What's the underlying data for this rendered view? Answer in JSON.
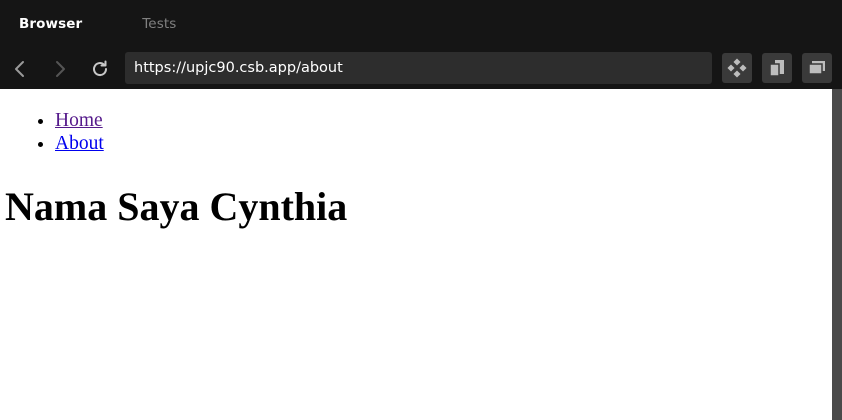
{
  "tabs": [
    {
      "label": "Browser",
      "active": true
    },
    {
      "label": "Tests",
      "active": false
    }
  ],
  "toolbar": {
    "url": "https://upjc90.csb.app/about",
    "back_icon": "chevron-left-icon",
    "forward_icon": "chevron-right-icon",
    "reload_icon": "reload-icon",
    "actions": [
      "codesandbox-icon",
      "open-new-window-icon",
      "layers-icon"
    ]
  },
  "page": {
    "nav_links": [
      {
        "label": "Home",
        "state": "visited"
      },
      {
        "label": "About",
        "state": "link"
      }
    ],
    "heading": "Nama Saya Cynthia"
  },
  "colors": {
    "chrome_bg": "#151515",
    "url_bg": "#2d2d2d",
    "tool_btn_bg": "#3a3a3a",
    "visited_link": "#551a8b",
    "link": "#0000ee",
    "scrollbar": "#4a4a4a"
  }
}
